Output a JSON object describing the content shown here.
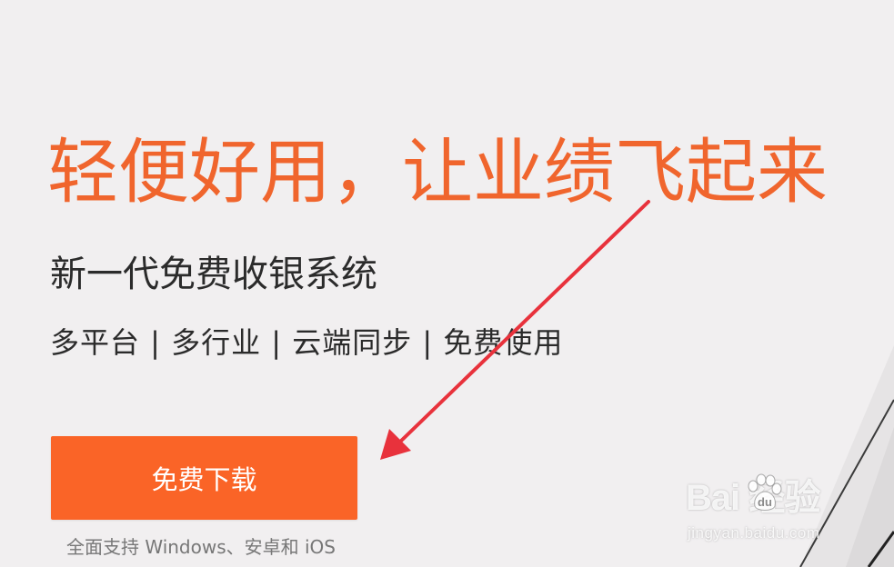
{
  "hero": {
    "title": "轻便好用，让业绩飞起来",
    "subtitle": "新一代免费收银系统",
    "features": "多平台 | 多行业 | 云端同步 | 免费使用"
  },
  "download": {
    "button_label": "免费下载",
    "platform_note": "全面支持 Windows、安卓和 iOS"
  },
  "watermark": {
    "logo_text": "Bai   经验",
    "url": "jingyan.baidu.com"
  },
  "colors": {
    "accent": "#f0652d",
    "button": "#fa6427",
    "annotation_arrow": "#e8323c",
    "background": "#f1eff0"
  },
  "icons": {
    "annotation": "red-arrow-icon",
    "watermark": "baidu-paw-icon"
  }
}
